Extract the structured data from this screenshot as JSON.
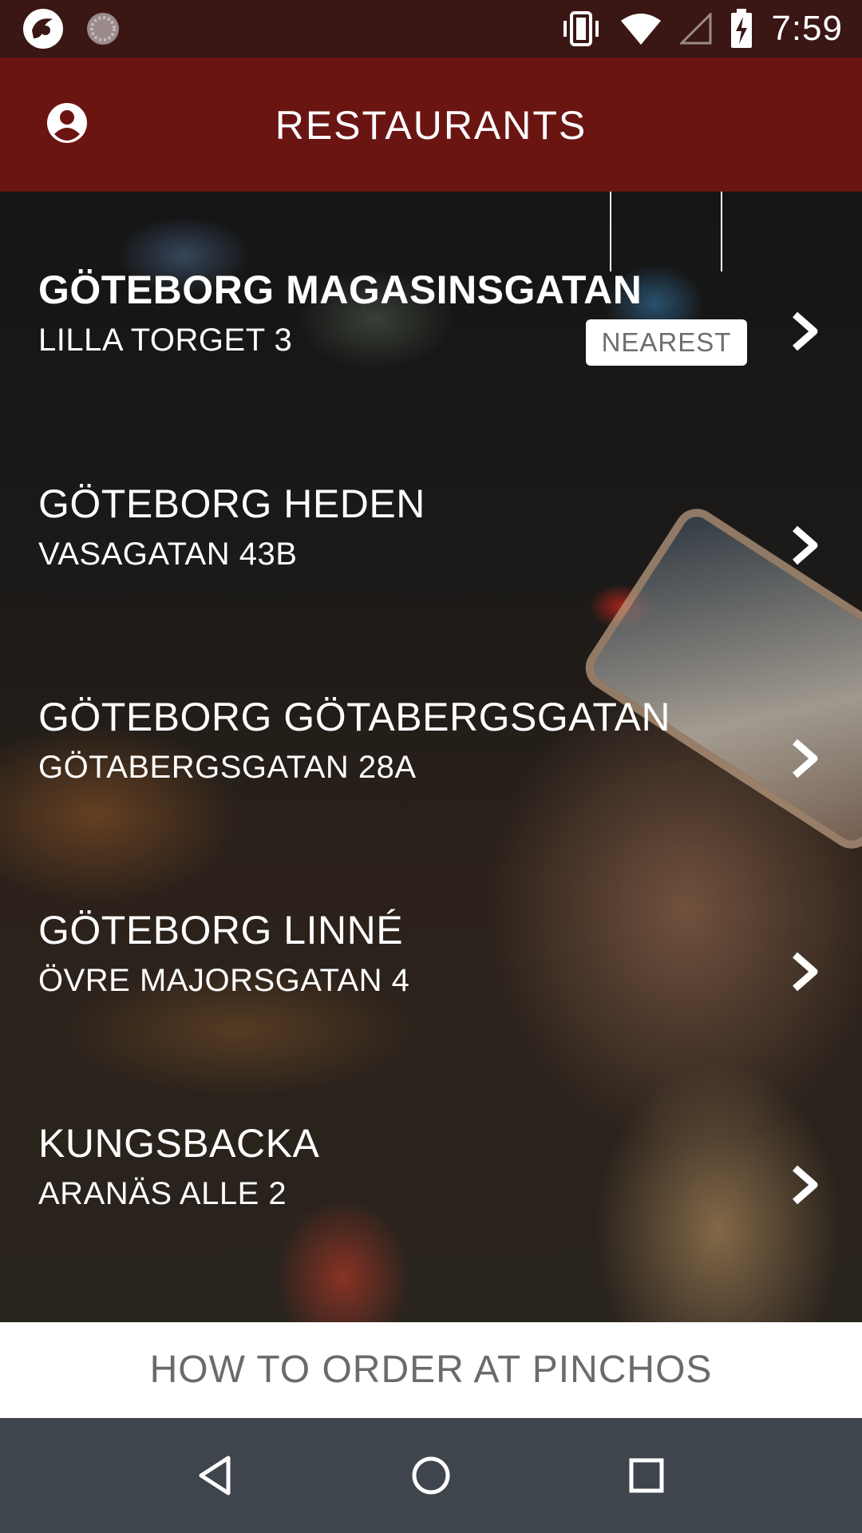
{
  "status_bar": {
    "time": "7:59"
  },
  "app_bar": {
    "title": "RESTAURANTS"
  },
  "restaurants": [
    {
      "name": "GÖTEBORG MAGASINSGATAN",
      "address": "LILLA TORGET 3",
      "badge": "NEAREST"
    },
    {
      "name": "GÖTEBORG HEDEN",
      "address": "VASAGATAN 43B"
    },
    {
      "name": "GÖTEBORG GÖTABERGSGATAN",
      "address": "GÖTABERGSGATAN 28A"
    },
    {
      "name": "GÖTEBORG LINNÉ",
      "address": "ÖVRE MAJORSGATAN 4"
    },
    {
      "name": "KUNGSBACKA",
      "address": "ARANÄS ALLE 2"
    }
  ],
  "footer": {
    "how_to_order_label": "HOW TO ORDER AT PINCHOS"
  },
  "icons": {
    "account": "account-circle-icon",
    "chevron": "chevron-right-icon",
    "nav_back": "back-triangle-icon",
    "nav_home": "home-circle-icon",
    "nav_recents": "recents-square-icon"
  },
  "colors": {
    "status_bar": "#3a1614",
    "app_bar": "#6b1513",
    "nav_bar": "#3e454c"
  }
}
